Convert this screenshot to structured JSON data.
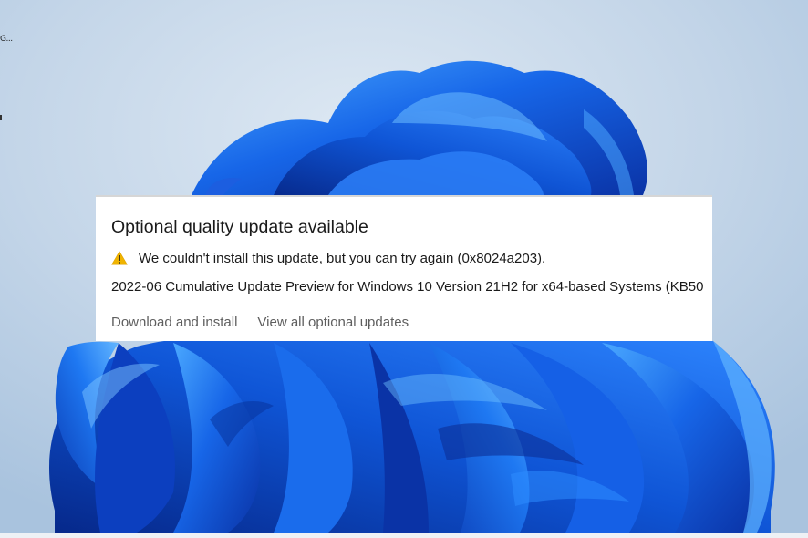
{
  "desktop": {
    "icon_label": "G..."
  },
  "update_panel": {
    "title": "Optional quality update available",
    "warning_icon": "warning-triangle-icon",
    "warning_color": "#f0b400",
    "warning_message": "We couldn't install this update, but you can try again (0x8024a203).",
    "update_name": "2022-06 Cumulative Update Preview for Windows 10 Version 21H2 for x64-based Systems (KB50",
    "actions": {
      "download_install": "Download and install",
      "view_optional": "View all optional updates"
    }
  },
  "colors": {
    "bloom_dark": "#0a3bb8",
    "bloom_mid": "#1565e6",
    "bloom_light": "#3ba0ff",
    "background": "#c7d8ea"
  }
}
